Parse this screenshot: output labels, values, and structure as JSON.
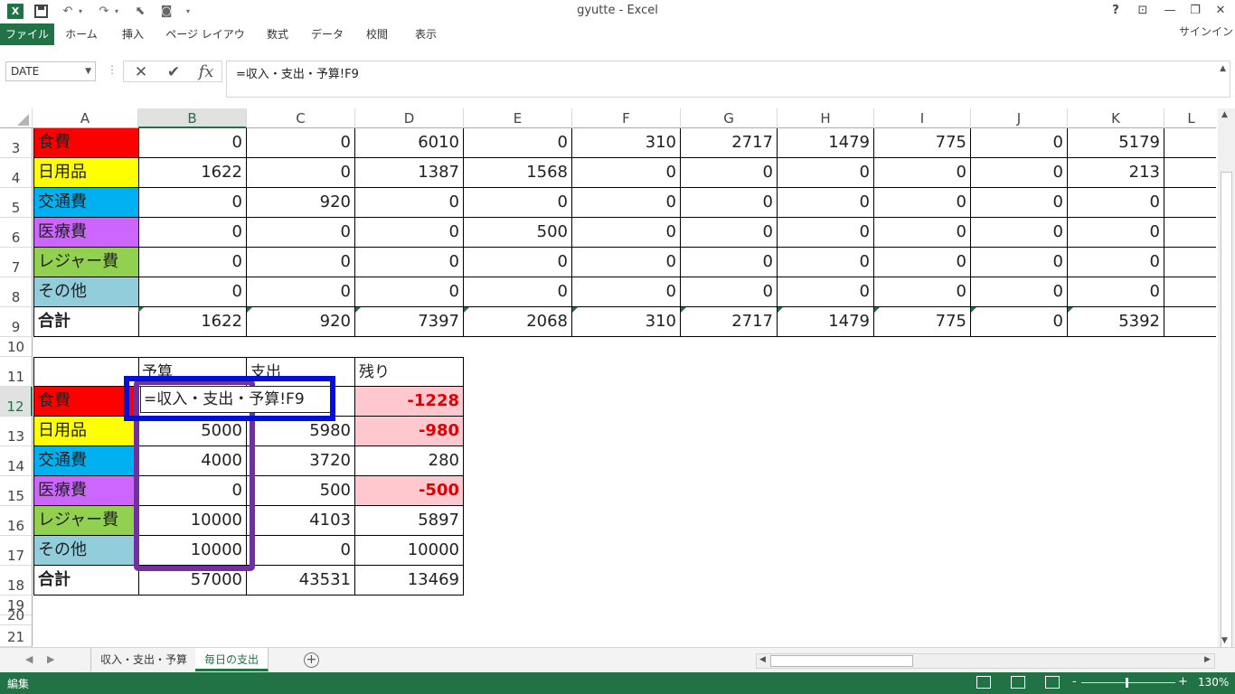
{
  "window": {
    "title": "gyutte - Excel",
    "help": "?",
    "signin": "サインイン",
    "app_icon_letter": "X"
  },
  "ribbon": {
    "tabs": [
      "ファイル",
      "ホーム",
      "挿入",
      "ページ レイアウト",
      "数式",
      "データ",
      "校閲",
      "表示"
    ]
  },
  "formula_bar": {
    "name_box": "DATE",
    "formula": "=収入・支出・予算!F9",
    "cancel_icon": "✕",
    "enter_icon": "✔",
    "fx_icon": "fx"
  },
  "columns": [
    "A",
    "B",
    "C",
    "D",
    "E",
    "F",
    "G",
    "H",
    "I",
    "J",
    "K",
    "L"
  ],
  "selected_column": "B",
  "rows": [
    "3",
    "4",
    "5",
    "6",
    "7",
    "8",
    "9",
    "10",
    "11",
    "12",
    "13",
    "14",
    "15",
    "16",
    "17",
    "18",
    "19",
    "20",
    "21"
  ],
  "selected_row": "12",
  "daily_table": [
    {
      "label": "食費",
      "color": "#ff0000",
      "values": [
        "0",
        "0",
        "6010",
        "0",
        "310",
        "2717",
        "1479",
        "775",
        "0",
        "5179"
      ]
    },
    {
      "label": "日用品",
      "color": "#ffff00",
      "values": [
        "1622",
        "0",
        "1387",
        "1568",
        "0",
        "0",
        "0",
        "0",
        "0",
        "213"
      ]
    },
    {
      "label": "交通費",
      "color": "#00b0f0",
      "values": [
        "0",
        "920",
        "0",
        "0",
        "0",
        "0",
        "0",
        "0",
        "0",
        "0"
      ]
    },
    {
      "label": "医療費",
      "color": "#cc66ff",
      "values": [
        "0",
        "0",
        "0",
        "500",
        "0",
        "0",
        "0",
        "0",
        "0",
        "0"
      ]
    },
    {
      "label": "レジャー費",
      "color": "#92d050",
      "values": [
        "0",
        "0",
        "0",
        "0",
        "0",
        "0",
        "0",
        "0",
        "0",
        "0"
      ]
    },
    {
      "label": "その他",
      "color": "#92cddc",
      "values": [
        "0",
        "0",
        "0",
        "0",
        "0",
        "0",
        "0",
        "0",
        "0",
        "0"
      ]
    },
    {
      "label": "合計",
      "color": "#ffffff",
      "values": [
        "1622",
        "920",
        "7397",
        "2068",
        "310",
        "2717",
        "1479",
        "775",
        "0",
        "5392"
      ]
    }
  ],
  "budget_table": {
    "headers": [
      "予算",
      "支出",
      "残り"
    ],
    "rows": [
      {
        "label": "食費",
        "color": "#ff0000",
        "budget": "=収入・支出・予算!F9",
        "spent": "",
        "remain": "-1228",
        "negative": true
      },
      {
        "label": "日用品",
        "color": "#ffff00",
        "budget": "5000",
        "spent": "5980",
        "remain": "-980",
        "negative": true
      },
      {
        "label": "交通費",
        "color": "#00b0f0",
        "budget": "4000",
        "spent": "3720",
        "remain": "280",
        "negative": false
      },
      {
        "label": "医療費",
        "color": "#cc66ff",
        "budget": "0",
        "spent": "500",
        "remain": "-500",
        "negative": true
      },
      {
        "label": "レジャー費",
        "color": "#92d050",
        "budget": "10000",
        "spent": "4103",
        "remain": "5897",
        "negative": false
      },
      {
        "label": "その他",
        "color": "#92cddc",
        "budget": "10000",
        "spent": "0",
        "remain": "10000",
        "negative": false
      },
      {
        "label": "合計",
        "color": "#ffffff",
        "budget": "57000",
        "spent": "43531",
        "remain": "13469",
        "negative": false
      }
    ]
  },
  "sheet_tabs": [
    "収入・支出・予算",
    "毎日の支出"
  ],
  "active_sheet": "毎日の支出",
  "status": {
    "mode": "編集",
    "zoom": "130%",
    "zoom_minus": "-",
    "zoom_plus": "+"
  },
  "colors": {
    "excel_green": "#217346",
    "annotation_blue": "#0010d6",
    "annotation_purple": "#7030a0",
    "negative_fill": "#ffc7ce",
    "negative_text": "#e00000"
  }
}
